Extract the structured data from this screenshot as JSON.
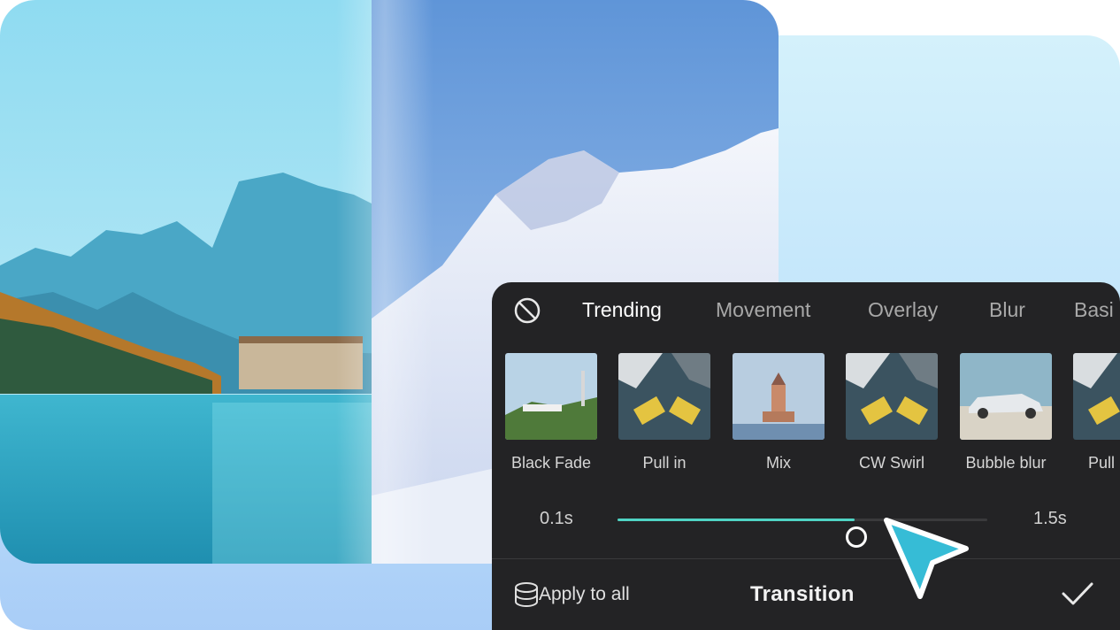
{
  "panel": {
    "tabs": [
      {
        "label": "Trending",
        "active": true
      },
      {
        "label": "Movement",
        "active": false
      },
      {
        "label": "Overlay",
        "active": false
      },
      {
        "label": "Blur",
        "active": false
      },
      {
        "label": "Basi",
        "active": false
      }
    ],
    "none_icon": "no-transition-icon",
    "thumbnails": [
      {
        "label": "Black Fade"
      },
      {
        "label": "Pull in"
      },
      {
        "label": "Mix"
      },
      {
        "label": "CW Swirl"
      },
      {
        "label": "Bubble blur"
      },
      {
        "label": "Pull"
      }
    ],
    "duration": {
      "min_label": "0.1s",
      "max_label": "1.5s",
      "level": 0.64
    },
    "footer": {
      "apply_label": "Apply to all",
      "title": "Transition",
      "confirm_icon": "checkmark-icon"
    }
  },
  "colors": {
    "accent": "#4fd3c4",
    "panel_bg": "#232325",
    "cursor": "#36bcd6"
  }
}
